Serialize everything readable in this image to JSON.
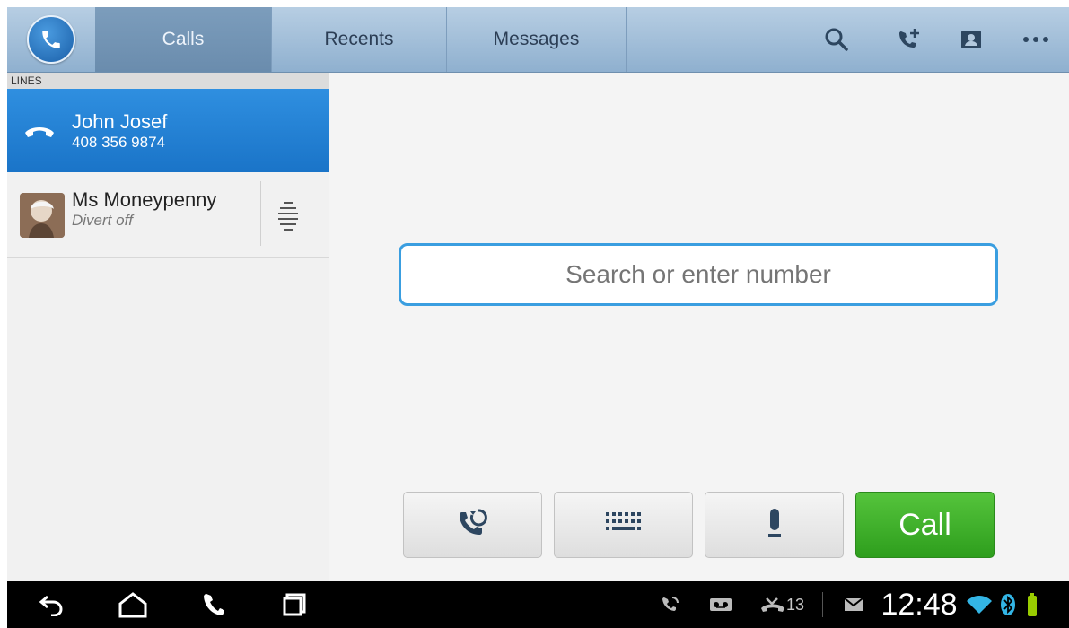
{
  "tabs": [
    {
      "label": "Calls",
      "active": true
    },
    {
      "label": "Recents",
      "active": false
    },
    {
      "label": "Messages",
      "active": false
    }
  ],
  "toolbar_icons": [
    "search-icon",
    "add-call-icon",
    "contact-card-icon",
    "more-icon"
  ],
  "sidebar": {
    "header": "LINES",
    "lines": [
      {
        "name": "John Josef",
        "sub": "408 356 9874",
        "active": true,
        "icon": "handset-icon"
      },
      {
        "name": "Ms Moneypenny",
        "sub": "Divert off",
        "active": false,
        "icon": "avatar"
      }
    ]
  },
  "main": {
    "search_placeholder": "Search or enter number",
    "buttons": {
      "redial_icon": "redial-icon",
      "keypad_icon": "keypad-icon",
      "mic_icon": "microphone-icon",
      "call_label": "Call"
    }
  },
  "statusbar": {
    "missed_calls": "13",
    "time": "12:48"
  },
  "colors": {
    "accent": "#1a74c8",
    "call_green": "#3aad27",
    "search_border": "#3a9ee0"
  }
}
